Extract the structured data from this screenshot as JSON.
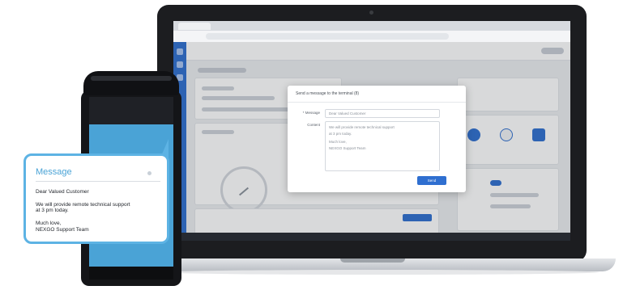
{
  "colors": {
    "accent": "#2f6fd0",
    "message_border": "#5db3e4",
    "pos_screen": "#4aa3d6",
    "laptop_bezel": "#1c1d20"
  },
  "icons": [
    "camera-icon",
    "sidebar-icon",
    "gauge-icon",
    "toggle-icon"
  ],
  "modal": {
    "title": "Send a message to the terminal (8)",
    "message_label": "* Message",
    "content_label": "Content",
    "content_lines": [
      "Dear Valued Customer",
      "We will provide remote technical support",
      "at 3 pm today.",
      "Much love,",
      "NEXGO Support Team"
    ],
    "send_label": "Send"
  },
  "message_popup": {
    "title": "Message",
    "greeting": "Dear Valued Customer",
    "body_line1": "We will provide remote technical support",
    "body_line2": "at 3 pm today.",
    "signoff": "Much love,",
    "signature": "NEXGO Support Team"
  }
}
